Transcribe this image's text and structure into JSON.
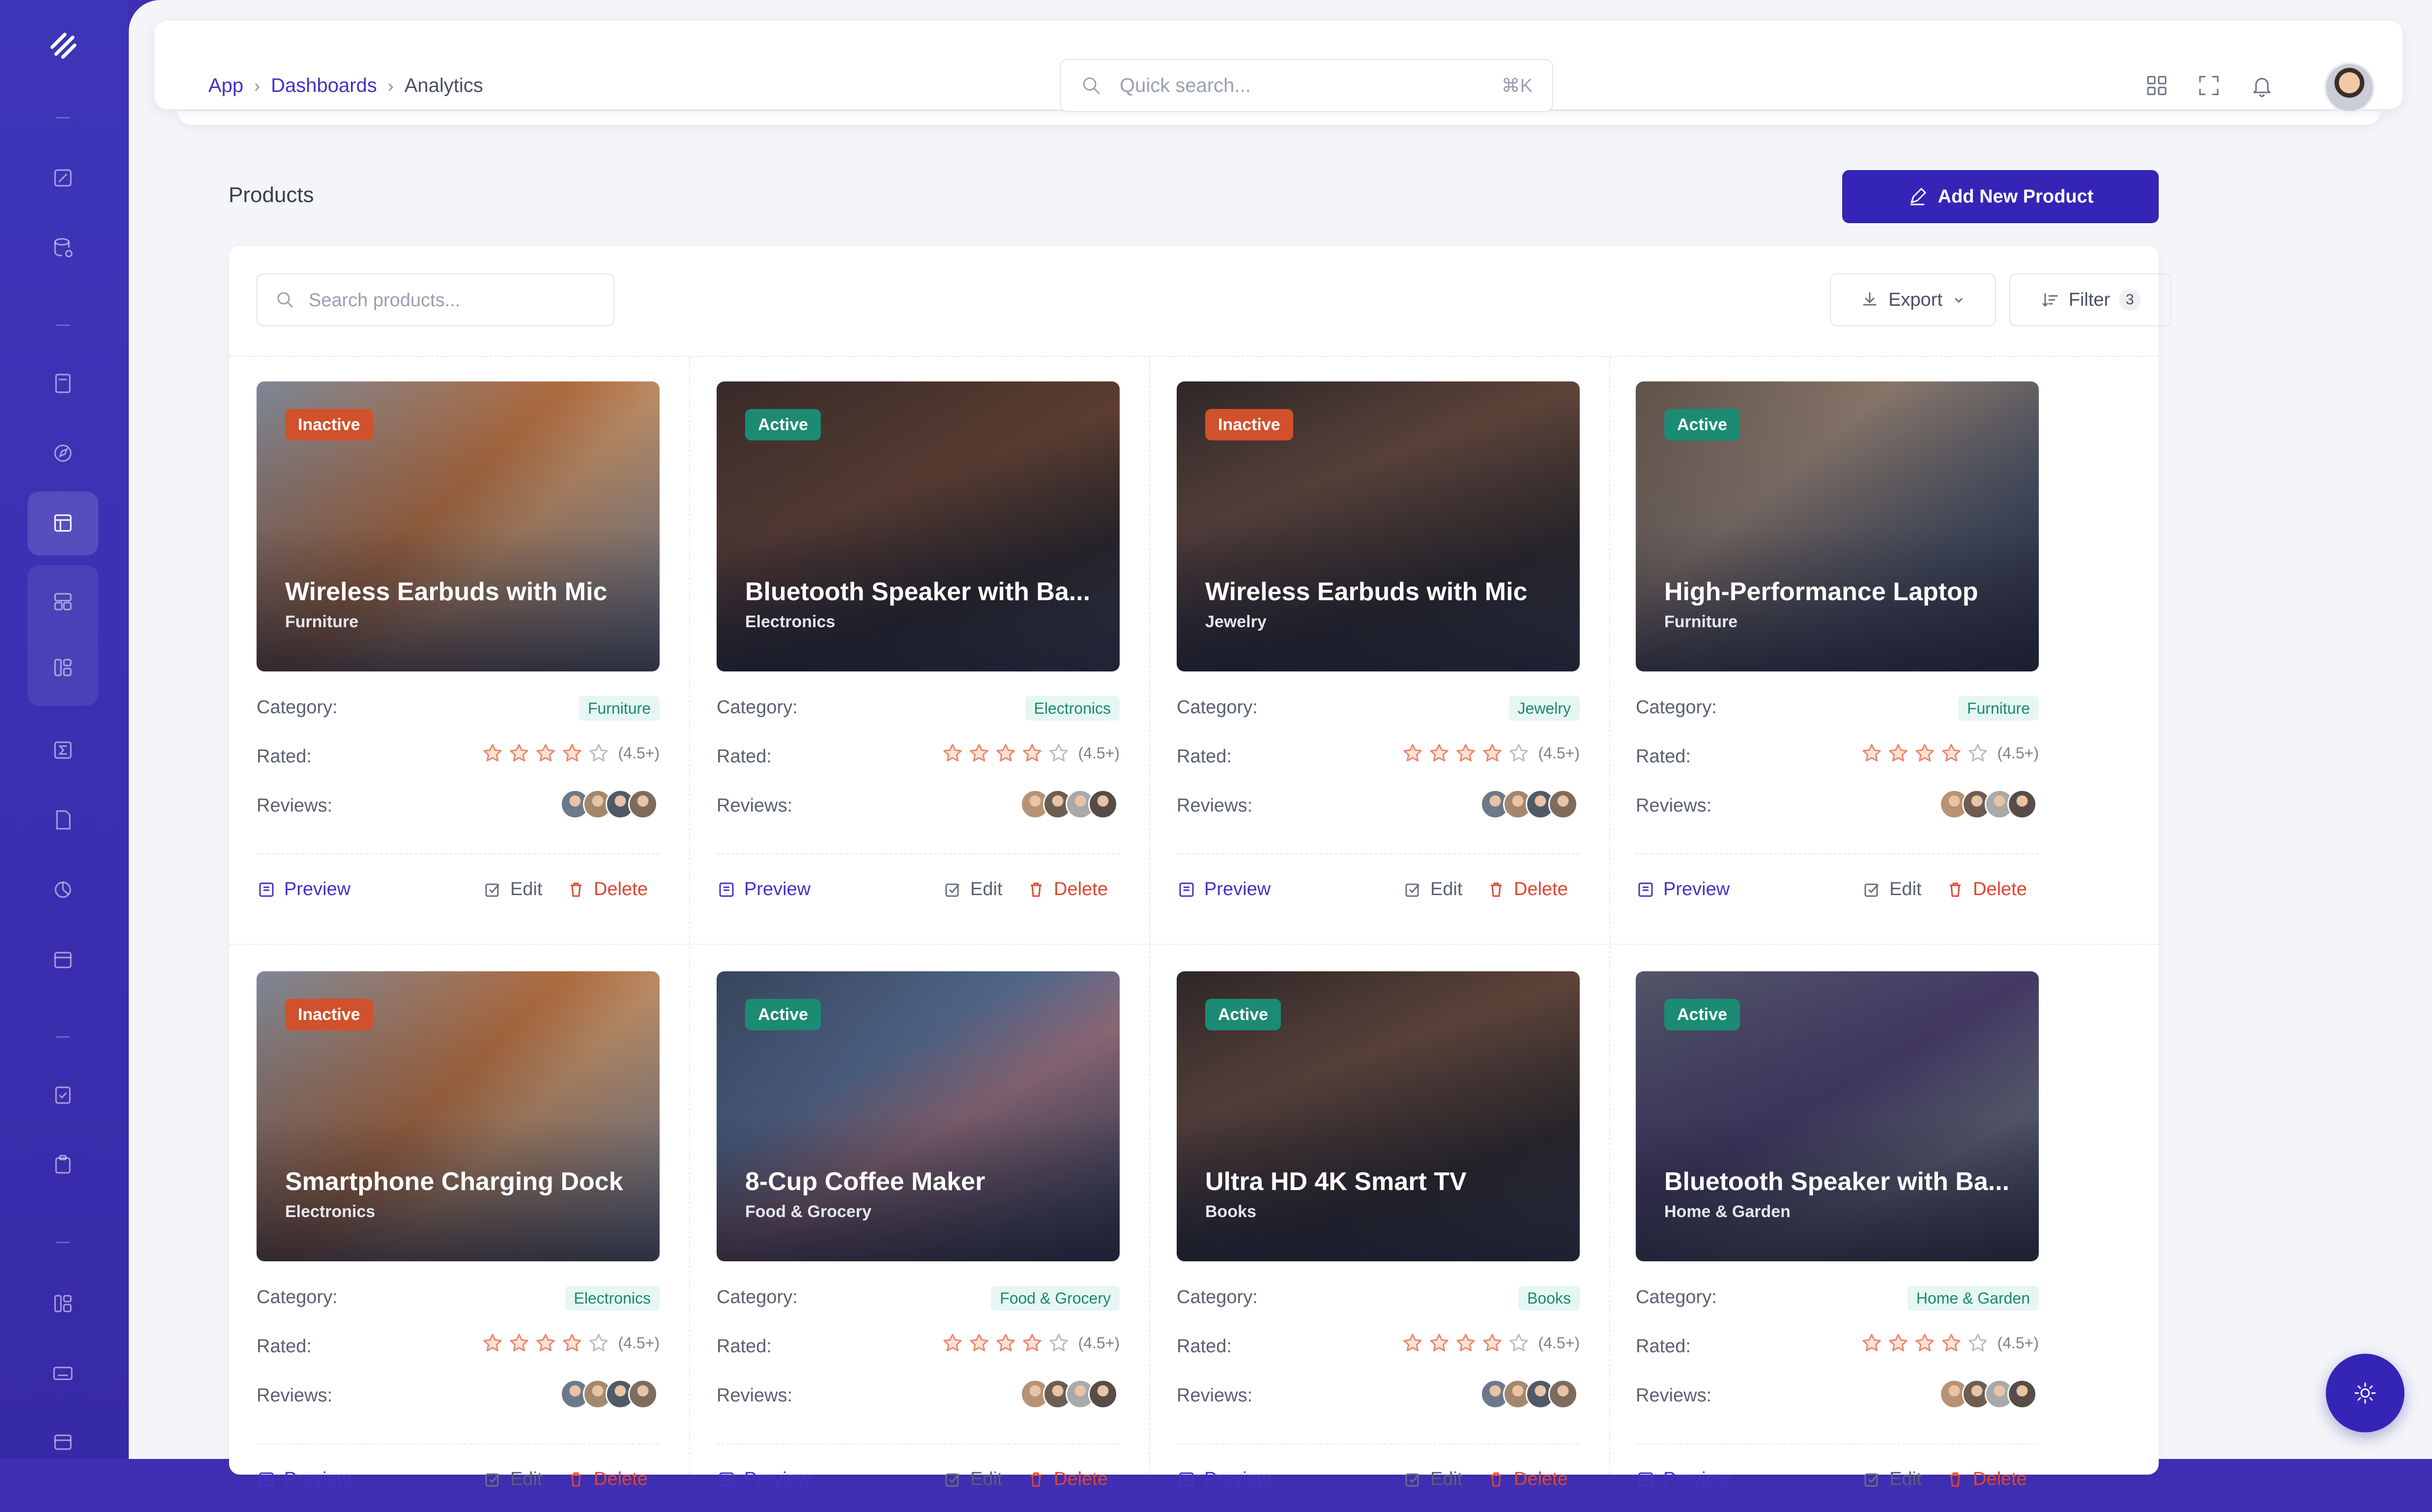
{
  "breadcrumb": {
    "items": [
      "App",
      "Dashboards",
      "Analytics"
    ]
  },
  "topbar": {
    "search_placeholder": "Quick search...",
    "search_shortcut": "⌘K"
  },
  "page": {
    "title": "Products",
    "add_button": "Add New Product"
  },
  "toolbar": {
    "search_placeholder": "Search products...",
    "export_label": "Export",
    "filter_label": "Filter",
    "filter_count": "3"
  },
  "labels": {
    "category": "Category:",
    "rated": "Rated:",
    "reviews": "Reviews:",
    "rating_note": "(4.5+)"
  },
  "actions": {
    "preview": "Preview",
    "edit": "Edit",
    "delete": "Delete"
  },
  "colors": {
    "accent": "#3525b6",
    "inactive": "#d0512b",
    "active": "#1c8b74",
    "delete": "#e0452f",
    "star": "#e8886a"
  },
  "products": [
    {
      "title": "Wireless Earbuds with Mic",
      "category": "Furniture",
      "status": "Inactive",
      "rating": 4
    },
    {
      "title": "Bluetooth Speaker with Ba...",
      "category": "Electronics",
      "status": "Active",
      "rating": 4
    },
    {
      "title": "Wireless Earbuds with Mic",
      "category": "Jewelry",
      "status": "Inactive",
      "rating": 4
    },
    {
      "title": "High-Performance Laptop",
      "category": "Furniture",
      "status": "Active",
      "rating": 4
    },
    {
      "title": "Smartphone Charging Dock",
      "category": "Electronics",
      "status": "Inactive",
      "rating": 4
    },
    {
      "title": "8-Cup Coffee Maker",
      "category": "Food & Grocery",
      "status": "Active",
      "rating": 4
    },
    {
      "title": "Ultra HD 4K Smart TV",
      "category": "Books",
      "status": "Active",
      "rating": 4
    },
    {
      "title": "Bluetooth Speaker with Ba...",
      "category": "Home & Garden",
      "status": "Active",
      "rating": 4
    }
  ]
}
